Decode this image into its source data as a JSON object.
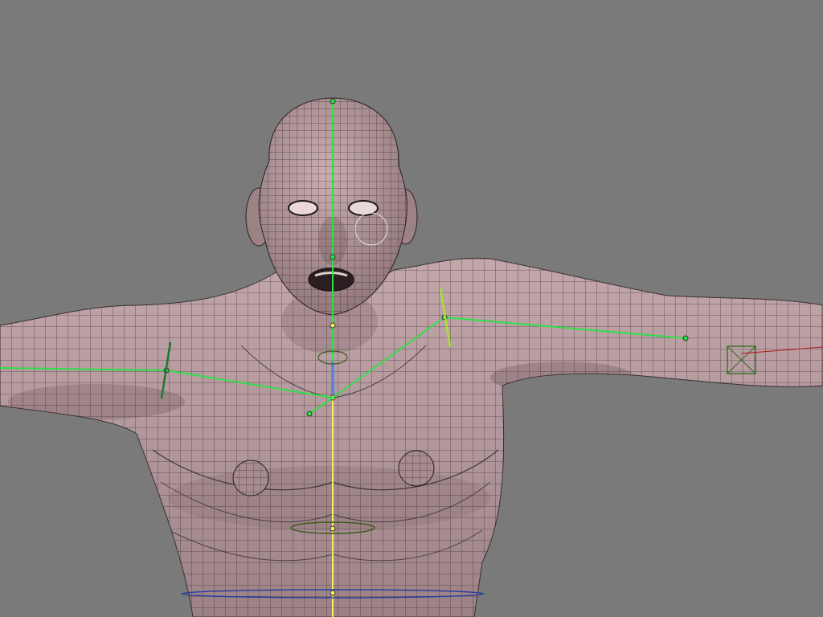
{
  "viewport": {
    "background": "#7a7a7a",
    "mesh_fill": "#b59a9e",
    "mesh_shadow": "#6e5659",
    "wire_color": "#2b2223",
    "bone_green": "#2ee04a",
    "bone_yellow": "#f3f060",
    "bone_blue": "#5a86d8",
    "empty_green": "#2d6b1f",
    "root_circle_blue": "#2a3fa0"
  },
  "objects": [
    {
      "kind": "mesh",
      "icon": "human-body-mesh"
    },
    {
      "kind": "armature",
      "icon": "bone-chain"
    },
    {
      "kind": "empty",
      "icon": "cube-empty"
    }
  ]
}
